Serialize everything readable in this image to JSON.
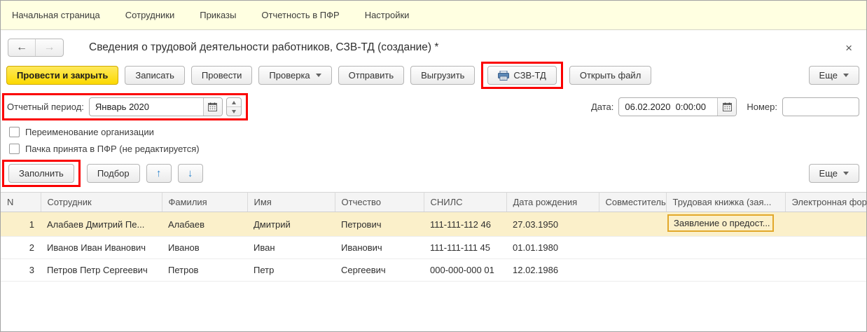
{
  "menu": {
    "items": [
      "Начальная страница",
      "Сотрудники",
      "Приказы",
      "Отчетность в ПФР",
      "Настройки"
    ]
  },
  "header": {
    "title": "Сведения о трудовой деятельности работников, СЗВ-ТД (создание) *"
  },
  "icons": {
    "back": "←",
    "forward": "→",
    "close": "×",
    "move_up": "↑",
    "move_down": "↓"
  },
  "toolbar": {
    "post_and_close": "Провести и закрыть",
    "write": "Записать",
    "post": "Провести",
    "check": "Проверка",
    "send": "Отправить",
    "unload": "Выгрузить",
    "szv_td": "СЗВ-ТД",
    "open_file": "Открыть файл",
    "more": "Еще"
  },
  "fields": {
    "period_label": "Отчетный период:",
    "period_value": "Январь 2020",
    "date_label": "Дата:",
    "date_value": "06.02.2020  0:00:00",
    "number_label": "Номер:",
    "number_value": ""
  },
  "checkboxes": [
    {
      "label": "Переименование организации",
      "checked": false
    },
    {
      "label": "Пачка принята в ПФР (не редактируется)",
      "checked": false
    }
  ],
  "table_toolbar": {
    "fill": "Заполнить",
    "pick": "Подбор",
    "more": "Еще"
  },
  "table": {
    "columns": [
      "N",
      "Сотрудник",
      "Фамилия",
      "Имя",
      "Отчество",
      "СНИЛС",
      "Дата рождения",
      "Совместитель",
      "Трудовая книжка (зая...",
      "Электронная фор"
    ],
    "rows": [
      {
        "n": "1",
        "employee": "Алабаев Дмитрий Пе...",
        "lastname": "Алабаев",
        "firstname": "Дмитрий",
        "middlename": "Петрович",
        "snils": "111-111-112 46",
        "birthdate": "27.03.1950",
        "parttime": "",
        "workbook": "Заявление о предост...",
        "eform": ""
      },
      {
        "n": "2",
        "employee": "Иванов Иван Иванович",
        "lastname": "Иванов",
        "firstname": "Иван",
        "middlename": "Иванович",
        "snils": "111-111-111 45",
        "birthdate": "01.01.1980",
        "parttime": "",
        "workbook": "",
        "eform": ""
      },
      {
        "n": "3",
        "employee": "Петров Петр Сергеевич",
        "lastname": "Петров",
        "firstname": "Петр",
        "middlename": "Сергеевич",
        "snils": "000-000-000 01",
        "birthdate": "12.02.1986",
        "parttime": "",
        "workbook": "",
        "eform": ""
      }
    ]
  },
  "colors": {
    "menubar_bg": "#ffffe1",
    "primary_button": "#fcd900",
    "highlight_red": "#fb0000",
    "selected_row": "#fbf0ca",
    "focused_cell_border": "#e2a82a",
    "move_arrow_blue": "#2f85cd"
  }
}
